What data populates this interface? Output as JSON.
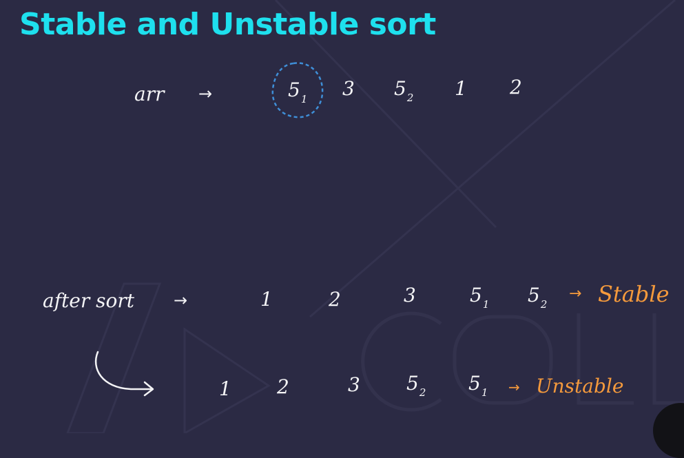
{
  "title": "Stable and Unstable sort",
  "arr": {
    "label": "arr",
    "arrow": "→",
    "items": [
      {
        "v": "5",
        "s": "1"
      },
      {
        "v": "3",
        "s": ""
      },
      {
        "v": "5",
        "s": "2"
      },
      {
        "v": "1",
        "s": ""
      },
      {
        "v": "2",
        "s": ""
      }
    ]
  },
  "stable": {
    "label": "after sort",
    "arrow": "→",
    "items": [
      {
        "v": "1",
        "s": ""
      },
      {
        "v": "2",
        "s": ""
      },
      {
        "v": "3",
        "s": ""
      },
      {
        "v": "5",
        "s": "1"
      },
      {
        "v": "5",
        "s": "2"
      }
    ],
    "result_arrow": "→",
    "result": "Stable"
  },
  "unstable": {
    "items": [
      {
        "v": "1",
        "s": ""
      },
      {
        "v": "2",
        "s": ""
      },
      {
        "v": "3",
        "s": ""
      },
      {
        "v": "5",
        "s": "2"
      },
      {
        "v": "5",
        "s": "1"
      }
    ],
    "result_arrow": "→",
    "result": "Unstable"
  },
  "colors": {
    "background": "#2b2a44",
    "title": "#1ee0ee",
    "ink": "#f4f4f6",
    "highlight": "#f59a3c",
    "circle": "#3f8fd8"
  }
}
